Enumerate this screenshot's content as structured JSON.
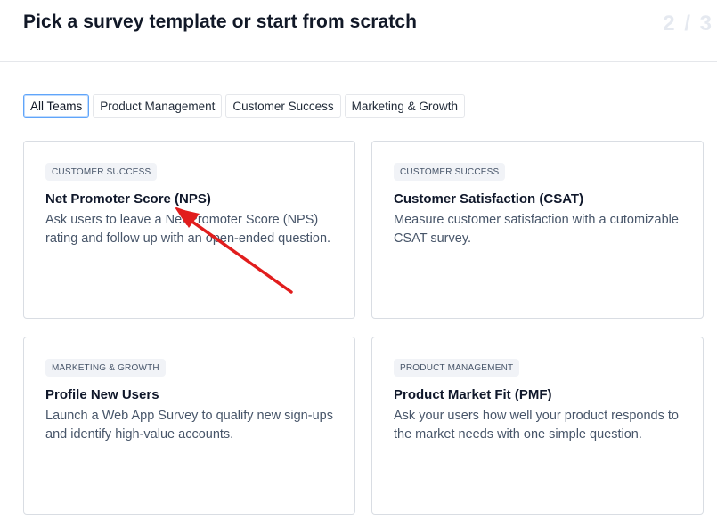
{
  "header": {
    "title": "Pick a survey template or start from scratch",
    "step": "2 / 3"
  },
  "filters": [
    {
      "label": "All Teams",
      "active": true
    },
    {
      "label": "Product Management",
      "active": false
    },
    {
      "label": "Customer Success",
      "active": false
    },
    {
      "label": "Marketing & Growth",
      "active": false
    }
  ],
  "templates": [
    {
      "badge": "CUSTOMER SUCCESS",
      "title": "Net Promoter Score (NPS)",
      "description": "Ask users to leave a Net Promoter Score (NPS) rating and follow up with an open-ended question."
    },
    {
      "badge": "CUSTOMER SUCCESS",
      "title": "Customer Satisfaction (CSAT)",
      "description": "Measure customer satisfaction with a cutomizable CSAT survey."
    },
    {
      "badge": "MARKETING & GROWTH",
      "title": "Profile New Users",
      "description": "Launch a Web App Survey to qualify new sign-ups and identify high-value accounts."
    },
    {
      "badge": "PRODUCT MANAGEMENT",
      "title": "Product Market Fit (PMF)",
      "description": "Ask your users how well your product responds to the market needs with one simple question."
    }
  ],
  "colors": {
    "active_filter_border": "#60a5fa",
    "annotation_arrow": "#e11d1d"
  }
}
